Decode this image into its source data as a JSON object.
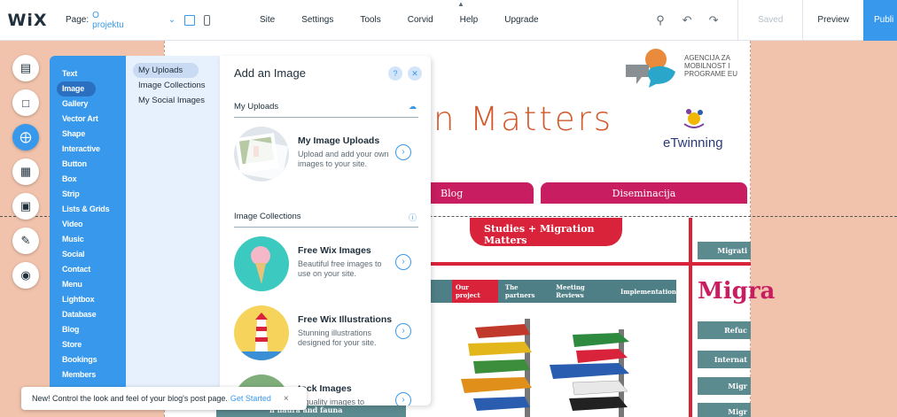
{
  "topbar": {
    "logo": "WiX",
    "page_label": "Page:",
    "page_value": "O projektu",
    "menu": [
      "Site",
      "Settings",
      "Tools",
      "Corvid",
      "Help",
      "Upgrade"
    ],
    "zoom_icon": "zoom-icon",
    "saved": "Saved",
    "preview": "Preview",
    "publish": "Publi"
  },
  "rail": {
    "icons": [
      "pages-icon",
      "background-icon",
      "add-icon",
      "app-market-icon",
      "media-icon",
      "blog-icon",
      "chat-icon"
    ]
  },
  "panel": {
    "categories": [
      "Text",
      "Image",
      "Gallery",
      "Vector Art",
      "Shape",
      "Interactive",
      "Button",
      "Box",
      "Strip",
      "Lists & Grids",
      "Video",
      "Music",
      "Social",
      "Contact",
      "Menu",
      "Lightbox",
      "Database",
      "Blog",
      "Store",
      "Bookings",
      "Members"
    ],
    "subcategories": [
      "My Uploads",
      "Image Collections",
      "My Social Images"
    ],
    "title": "Add an Image",
    "section_uploads": "My Uploads",
    "section_collections": "Image Collections",
    "items": [
      {
        "title": "My Image Uploads",
        "desc": "Upload and add your own images to your site."
      },
      {
        "title": "Free Wix Images",
        "desc": "Beautiful free images to use on your site."
      },
      {
        "title": "Free Wix Illustrations",
        "desc": "Stunning illustrations designed for your site."
      },
      {
        "title": "tock Images",
        "desc": "h quality images to"
      }
    ]
  },
  "site": {
    "headline": "n Matters",
    "agency": "AGENCIJA ZA MOBILNOST I PROGRAME EU",
    "etwinning": "eTwinning",
    "nav_blog": "Blog",
    "nav_dis": "Diseminacija",
    "banner": "Studies + Migration Matters",
    "tabs": [
      "Our project",
      "The partners",
      "Meeting Reviews",
      "Implementation"
    ],
    "migra": "Migra",
    "side_buttons": [
      "Migrati",
      "Refuc",
      "Internat",
      "Migr",
      "Migr"
    ],
    "strip": "n flaura and fauna"
  },
  "toast": {
    "text": "New! Control the look and feel of your blog's post page.",
    "link": "Get Started",
    "close": "×"
  }
}
